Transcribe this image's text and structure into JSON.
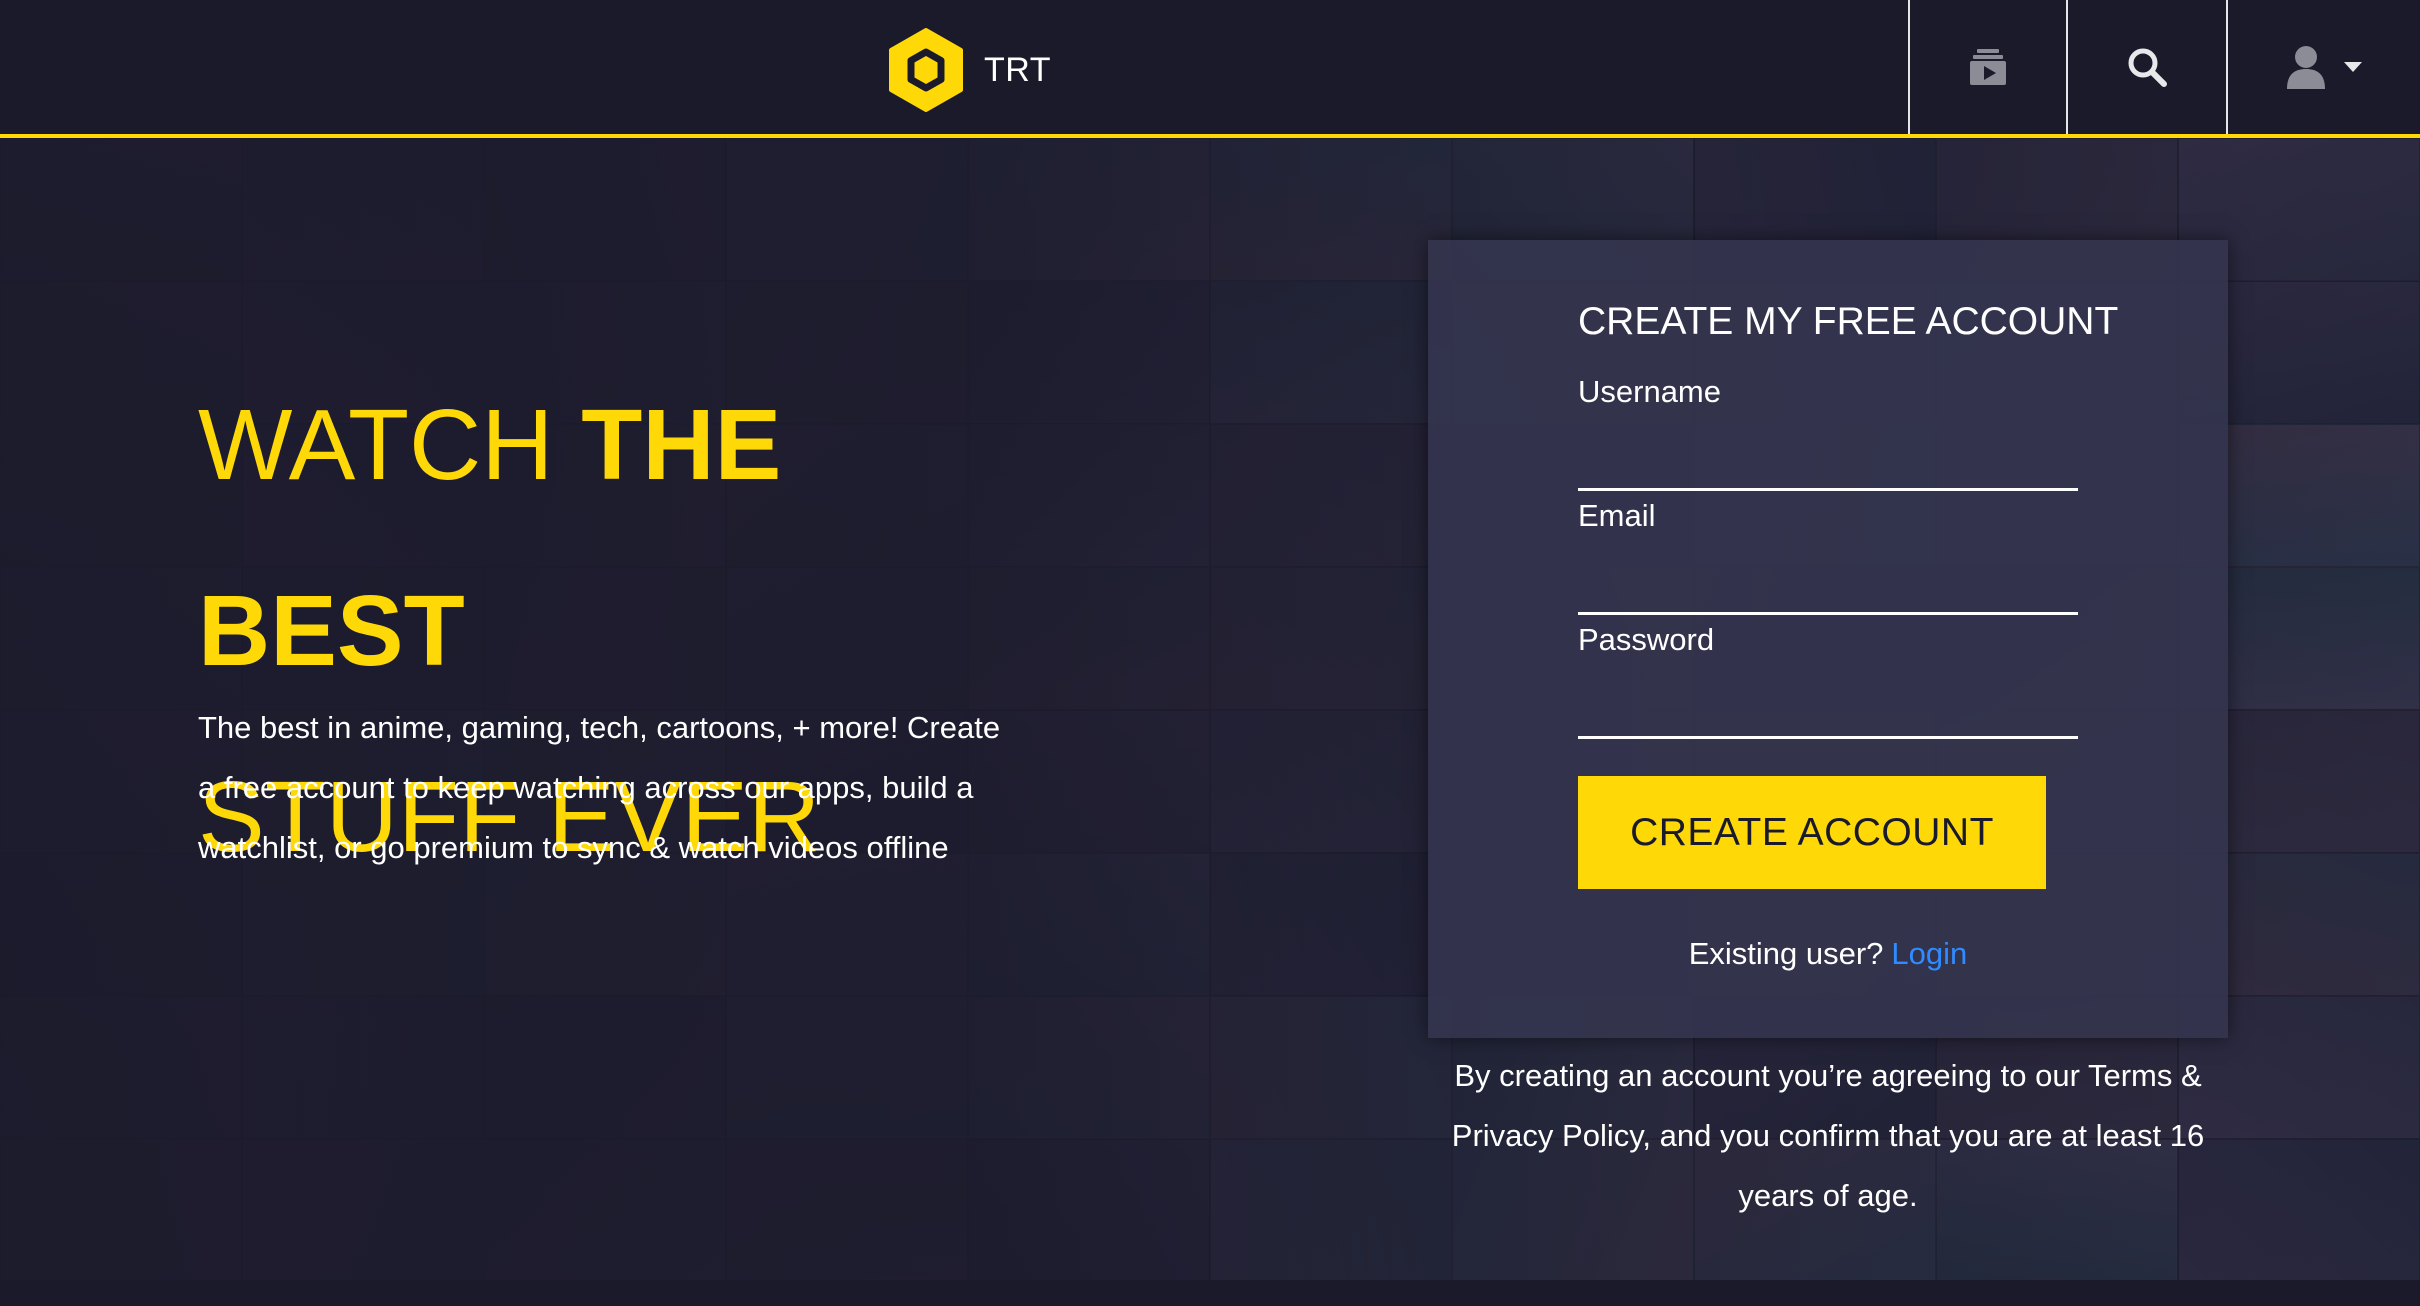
{
  "brand": {
    "name": "TRT",
    "accent": "#ffd907",
    "background": "#1b1a2b",
    "link": "#2f8bff"
  },
  "header": {
    "icons": {
      "queue": "queue-icon",
      "search": "search-icon",
      "user": "user-icon",
      "dropdown": "chevron-down-icon"
    }
  },
  "hero": {
    "headline_light": "WATCH",
    "headline_bold": "THE BEST",
    "headline_line2": "STUFF EVER",
    "tagline": "The best in anime, gaming, tech, cartoons, + more! Create a free account to keep watching across our apps, build a watchlist, or go premium to sync & watch videos offline"
  },
  "signup": {
    "title": "CREATE MY FREE ACCOUNT",
    "username_label": "Username",
    "username_value": "",
    "email_label": "Email",
    "email_value": "",
    "password_label": "Password",
    "password_value": "",
    "button_label": "CREATE ACCOUNT",
    "existing_text": "Existing user?",
    "login_label": "Login",
    "legal": "By creating an account you’re agreeing to our Terms & Privacy Policy, and you confirm that you are at least 16 years of age."
  }
}
